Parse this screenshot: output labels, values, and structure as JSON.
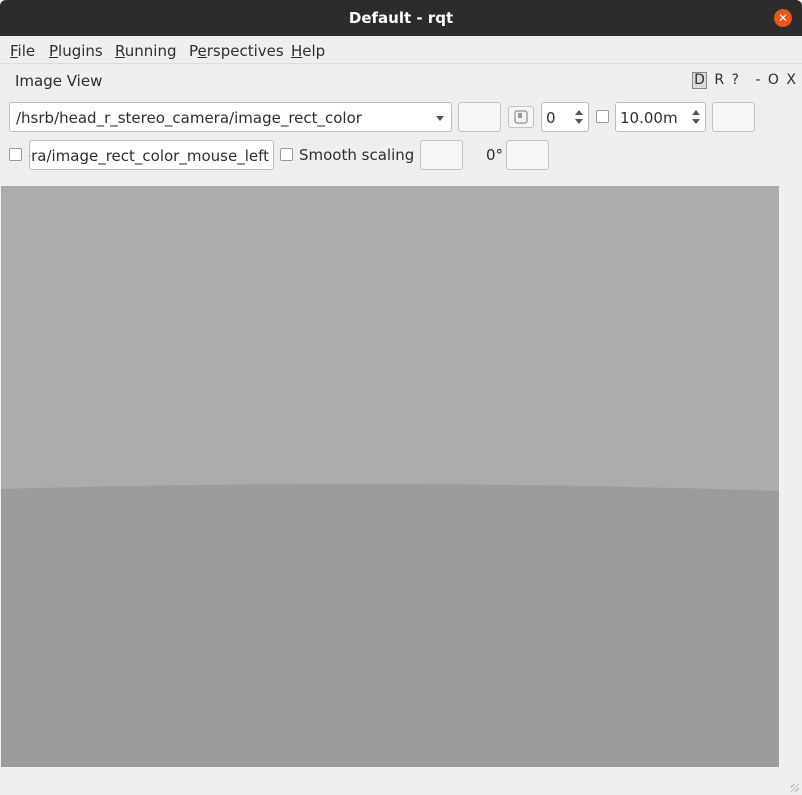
{
  "window": {
    "title": "Default - rqt"
  },
  "menu": [
    {
      "label": "File",
      "mnemonic": "F"
    },
    {
      "label": "Plugins",
      "mnemonic": "P"
    },
    {
      "label": "Running",
      "mnemonic": "R"
    },
    {
      "label": "Perspectives",
      "mnemonic": "e"
    },
    {
      "label": "Help",
      "mnemonic": "H"
    }
  ],
  "plugin": {
    "title": "Image View",
    "dock_buttons": {
      "d": "D",
      "r": "R",
      "help": "?",
      "minimize": "-",
      "float": "O",
      "close": "X"
    }
  },
  "toolbar": {
    "topic": "/hsrb/head_r_stereo_camera/image_rect_color",
    "smoothing_value": "0",
    "max_range": "10.00m",
    "mouse_topic": "era/image_rect_color_mouse_left",
    "smooth_scaling_label": "Smooth scaling",
    "rotation": "0°"
  },
  "image": {
    "sky_color": "#acacac",
    "floor_color": "#9c9c9c"
  }
}
